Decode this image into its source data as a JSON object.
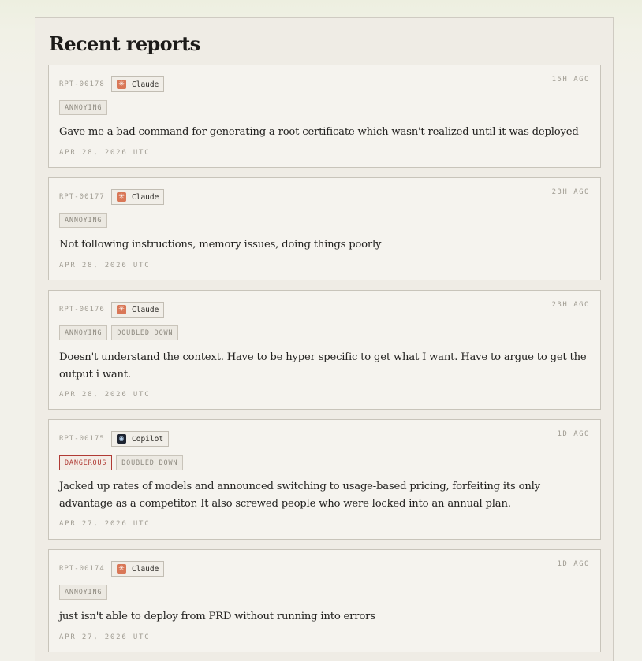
{
  "page": {
    "title": "Recent reports"
  },
  "reports": [
    {
      "id": "RPT-00178",
      "agent": "Claude",
      "agent_icon": "claude-logo-icon",
      "ago": "15H AGO",
      "tags": [
        "ANNOYING"
      ],
      "description": "Gave me a bad command for generating a root certificate which wasn't realized until it was deployed",
      "date": "APR 28, 2026 UTC"
    },
    {
      "id": "RPT-00177",
      "agent": "Claude",
      "agent_icon": "claude-logo-icon",
      "ago": "23H AGO",
      "tags": [
        "ANNOYING"
      ],
      "description": "Not following instructions, memory issues, doing things poorly",
      "date": "APR 28, 2026 UTC"
    },
    {
      "id": "RPT-00176",
      "agent": "Claude",
      "agent_icon": "claude-logo-icon",
      "ago": "23H AGO",
      "tags": [
        "ANNOYING",
        "DOUBLED DOWN"
      ],
      "description": "Doesn't understand the context. Have to be hyper specific to get what I want. Have to argue to get the output i want.",
      "date": "APR 28, 2026 UTC"
    },
    {
      "id": "RPT-00175",
      "agent": "Copilot",
      "agent_icon": "copilot-logo-icon",
      "ago": "1D AGO",
      "tags": [
        "DANGEROUS",
        "DOUBLED DOWN"
      ],
      "description": "Jacked up rates of models and announced switching to usage-based pricing, forfeiting its only advantage as a competitor. It also screwed people who were locked into an annual plan.",
      "date": "APR 27, 2026 UTC"
    },
    {
      "id": "RPT-00174",
      "agent": "Claude",
      "agent_icon": "claude-logo-icon",
      "ago": "1D AGO",
      "tags": [
        "ANNOYING"
      ],
      "description": "just isn't able to deploy from PRD without running into errors",
      "date": "APR 27, 2026 UTC"
    }
  ],
  "colors": {
    "danger": "#b03a34",
    "claude_brand": "#d97757",
    "copilot_brand": "#1d2330"
  }
}
